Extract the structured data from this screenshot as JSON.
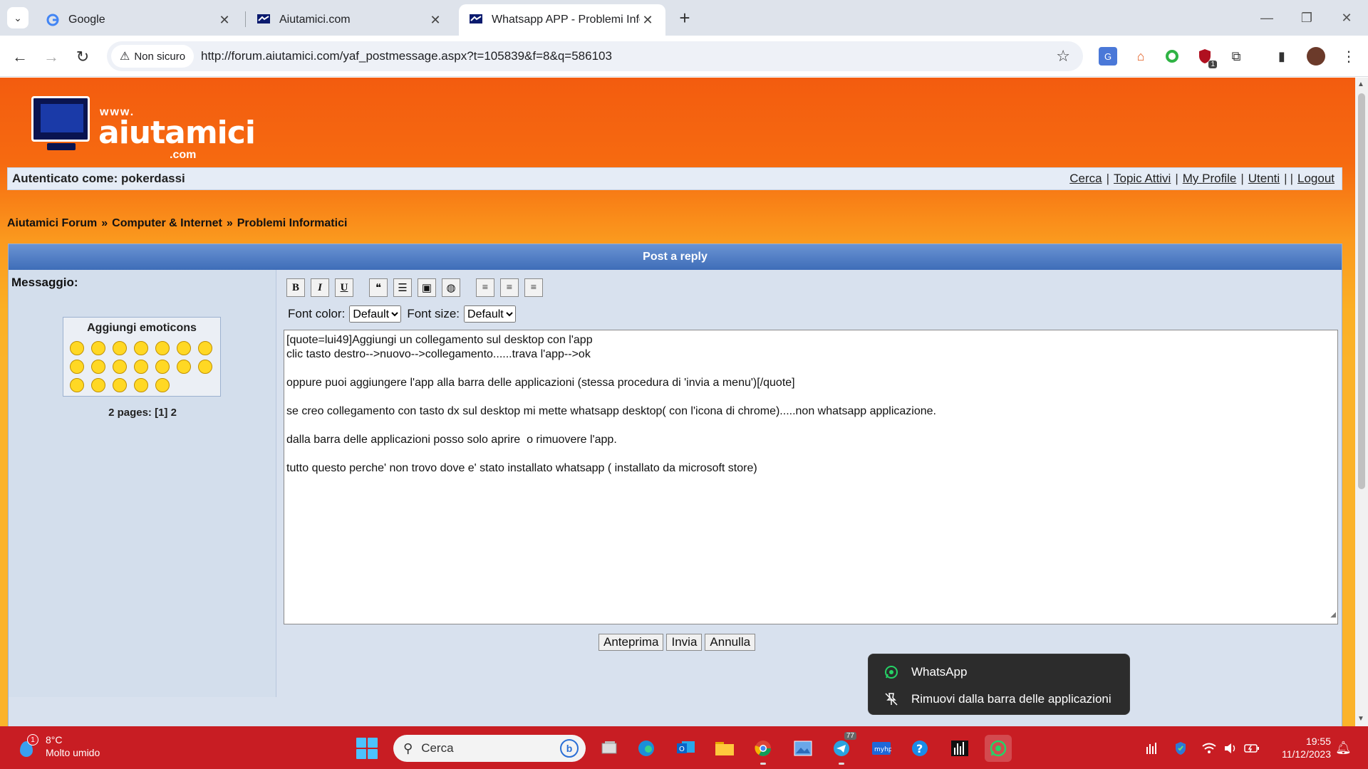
{
  "browser": {
    "tabs": [
      {
        "title": "Google"
      },
      {
        "title": "Aiutamici.com"
      },
      {
        "title": "Whatsapp APP - Problemi Informatici"
      }
    ],
    "security_label": "Non sicuro",
    "url": "http://forum.aiutamici.com/yaf_postmessage.aspx?t=105839&f=8&q=586103",
    "extension_badge": "1"
  },
  "site": {
    "logo": {
      "www": "www.",
      "name": "aiutamici",
      "tld": ".com"
    },
    "auth_label": "Autenticato come: pokerdassi",
    "nav_links": [
      "Cerca",
      "Topic Attivi",
      "My Profile",
      "Utenti",
      "Logout"
    ],
    "breadcrumb": [
      "Aiutamici Forum",
      "Computer & Internet",
      "Problemi Informatici"
    ],
    "breadcrumb_sep": "»"
  },
  "post": {
    "header": "Post a reply",
    "message_label": "Messaggio:",
    "emoticons_title": "Aggiungi emoticons",
    "pages_label": "2 pages: [1] 2",
    "toolbar": {
      "bold": "B",
      "italic": "I",
      "underline": "U"
    },
    "font_color_label": "Font color:",
    "font_color_value": "Default",
    "font_size_label": "Font size:",
    "font_size_value": "Default",
    "body_lines": [
      "[quote=lui49]Aggiungi un collegamento sul desktop con l'app",
      "clic tasto destro-->nuovo-->collegamento......trava l'app-->ok",
      "",
      "oppure puoi aggiungere l'app alla barra delle applicazioni (stessa procedura di 'invia a menu')[/quote]",
      "",
      "se creo collegamento con tasto dx sul desktop mi mette whatsapp desktop( con l'icona di chrome).....non whatsapp applicazione.",
      "",
      "dalla barra delle applicazioni posso solo aprire  o rimuovere l'app.",
      "",
      "tutto questo perche' non trovo dove e' stato installato whatsapp ( installato da microsoft store)"
    ],
    "buttons": {
      "preview": "Anteprima",
      "send": "Invia",
      "cancel": "Annulla"
    }
  },
  "context_menu": {
    "items": [
      "WhatsApp",
      "Rimuovi dalla barra delle applicazioni"
    ]
  },
  "taskbar": {
    "weather_temp": "8°C",
    "weather_desc": "Molto umido",
    "weather_badge": "1",
    "search_placeholder": "Cerca",
    "telegram_badge": "77",
    "time": "19:55",
    "date": "11/12/2023"
  },
  "colors": {
    "page_orange": "#f35c0f",
    "header_blue": "#3e6db8",
    "taskbar_red": "#c81d23",
    "whatsapp_green": "#25d366"
  }
}
